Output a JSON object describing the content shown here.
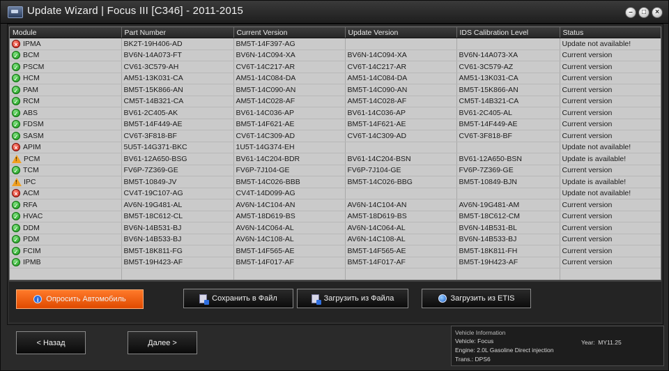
{
  "window": {
    "title": "Update Wizard | Focus III [C346] - 2011-2015",
    "controls": {
      "minimize": "–",
      "maximize": "□",
      "close": "×"
    }
  },
  "grid": {
    "columns": [
      "Module",
      "Part Number",
      "Current Version",
      "Update Version",
      "IDS Calibration Level",
      "Status"
    ],
    "rows": [
      {
        "status_icon": "error-icon",
        "module": "IPMA",
        "part": "BK2T-19H406-AD",
        "current": "BM5T-14F397-AG",
        "update": "",
        "ids": "",
        "status": "Update not available!"
      },
      {
        "status_icon": "check-icon",
        "module": "BCM",
        "part": "BV6N-14A073-FT",
        "current": "BV6N-14C094-XA",
        "update": "BV6N-14C094-XA",
        "ids": "BV6N-14A073-XA",
        "status": "Current version"
      },
      {
        "status_icon": "check-icon",
        "module": "PSCM",
        "part": "CV61-3C579-AH",
        "current": "CV6T-14C217-AR",
        "update": "CV6T-14C217-AR",
        "ids": "CV61-3C579-AZ",
        "status": "Current version"
      },
      {
        "status_icon": "check-icon",
        "module": "HCM",
        "part": "AM51-13K031-CA",
        "current": "AM51-14C084-DA",
        "update": "AM51-14C084-DA",
        "ids": "AM51-13K031-CA",
        "status": "Current version"
      },
      {
        "status_icon": "check-icon",
        "module": "PAM",
        "part": "BM5T-15K866-AN",
        "current": "BM5T-14C090-AN",
        "update": "BM5T-14C090-AN",
        "ids": "BM5T-15K866-AN",
        "status": "Current version"
      },
      {
        "status_icon": "check-icon",
        "module": "RCM",
        "part": "CM5T-14B321-CA",
        "current": "AM5T-14C028-AF",
        "update": "AM5T-14C028-AF",
        "ids": "CM5T-14B321-CA",
        "status": "Current version"
      },
      {
        "status_icon": "check-icon",
        "module": "ABS",
        "part": "BV61-2C405-AK",
        "current": "BV61-14C036-AP",
        "update": "BV61-14C036-AP",
        "ids": "BV61-2C405-AL",
        "status": "Current version"
      },
      {
        "status_icon": "check-icon",
        "module": "FDSM",
        "part": "BM5T-14F449-AE",
        "current": "BM5T-14F621-AE",
        "update": "BM5T-14F621-AE",
        "ids": "BM5T-14F449-AE",
        "status": "Current version"
      },
      {
        "status_icon": "check-icon",
        "module": "SASM",
        "part": "CV6T-3F818-BF",
        "current": "CV6T-14C309-AD",
        "update": "CV6T-14C309-AD",
        "ids": "CV6T-3F818-BF",
        "status": "Current version"
      },
      {
        "status_icon": "error-icon",
        "module": "APIM",
        "part": "5U5T-14G371-BKC",
        "current": "1U5T-14G374-EH",
        "update": "",
        "ids": "",
        "status": "Update not available!"
      },
      {
        "status_icon": "warning-icon",
        "module": "PCM",
        "part": "BV61-12A650-BSG",
        "current": "BV61-14C204-BDR",
        "update": "BV61-14C204-BSN",
        "ids": "BV61-12A650-BSN",
        "status": "Update is available!"
      },
      {
        "status_icon": "check-icon",
        "module": "TCM",
        "part": "FV6P-7Z369-GE",
        "current": "FV6P-7J104-GE",
        "update": "FV6P-7J104-GE",
        "ids": "FV6P-7Z369-GE",
        "status": "Current version"
      },
      {
        "status_icon": "warning-icon",
        "module": "IPC",
        "part": "BM5T-10849-JV",
        "current": "BM5T-14C026-BBB",
        "update": "BM5T-14C026-BBG",
        "ids": "BM5T-10849-BJN",
        "status": "Update is available!"
      },
      {
        "status_icon": "error-icon",
        "module": "ACM",
        "part": "CV4T-19C107-AG",
        "current": "CV4T-14D099-AG",
        "update": "",
        "ids": "",
        "status": "Update not available!"
      },
      {
        "status_icon": "check-icon",
        "module": "RFA",
        "part": "AV6N-19G481-AL",
        "current": "AV6N-14C104-AN",
        "update": "AV6N-14C104-AN",
        "ids": "AV6N-19G481-AM",
        "status": "Current version"
      },
      {
        "status_icon": "check-icon",
        "module": "HVAC",
        "part": "BM5T-18C612-CL",
        "current": "AM5T-18D619-BS",
        "update": "AM5T-18D619-BS",
        "ids": "BM5T-18C612-CM",
        "status": "Current version"
      },
      {
        "status_icon": "check-icon",
        "module": "DDM",
        "part": "BV6N-14B531-BJ",
        "current": "AV6N-14C064-AL",
        "update": "AV6N-14C064-AL",
        "ids": "BV6N-14B531-BL",
        "status": "Current version"
      },
      {
        "status_icon": "check-icon",
        "module": "PDM",
        "part": "BV6N-14B533-BJ",
        "current": "AV6N-14C108-AL",
        "update": "AV6N-14C108-AL",
        "ids": "BV6N-14B533-BJ",
        "status": "Current version"
      },
      {
        "status_icon": "check-icon",
        "module": "FCIM",
        "part": "BM5T-18K811-FG",
        "current": "BM5T-14F565-AE",
        "update": "BM5T-14F565-AE",
        "ids": "BM5T-18K811-FH",
        "status": "Current version"
      },
      {
        "status_icon": "check-icon",
        "module": "IPMB",
        "part": "BM5T-19H423-AF",
        "current": "BM5T-14F017-AF",
        "update": "BM5T-14F017-AF",
        "ids": "BM5T-19H423-AF",
        "status": "Current version"
      }
    ]
  },
  "actions": {
    "poll": "Опросить Автомобиль",
    "save": "Сохранить в Файл",
    "load_file": "Загрузить из Файла",
    "load_etis": "Загрузить из ETIS"
  },
  "nav": {
    "back": "< Назад",
    "next": "Далее >"
  },
  "vehicle_info": {
    "title": "Vehicle Information",
    "vehicle_label": "Vehicle:",
    "vehicle": "Focus",
    "engine_label": "Engine:",
    "engine": "2.0L Gasoline Direct injection",
    "trans_label": "Trans.:",
    "trans": "DPS6",
    "year_label": "Year:",
    "year": "MY11.25"
  },
  "colors": {
    "accent": "#f25a0f",
    "ok": "#1fa21f",
    "error": "#c81b10",
    "warning": "#f0a020"
  }
}
